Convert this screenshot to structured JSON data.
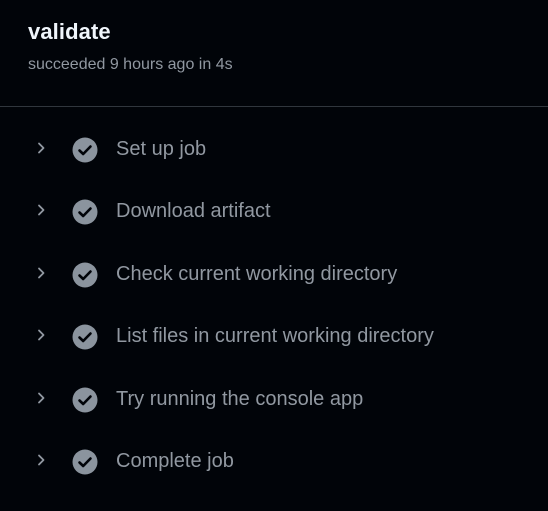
{
  "job": {
    "title": "validate",
    "meta": "succeeded 9 hours ago in 4s"
  },
  "steps": [
    {
      "label": "Set up job",
      "status": "success"
    },
    {
      "label": "Download artifact",
      "status": "success"
    },
    {
      "label": "Check current working directory",
      "status": "success"
    },
    {
      "label": "List files in current working directory",
      "status": "success"
    },
    {
      "label": "Try running the console app",
      "status": "success"
    },
    {
      "label": "Complete job",
      "status": "success"
    }
  ],
  "colors": {
    "background": "#010409",
    "title": "#f0f6fc",
    "muted": "#9198a1",
    "check_circle": "#8b949e",
    "divider": "#30363d"
  },
  "icons": {
    "expand": "chevron-right-icon",
    "status": "check-circle-icon"
  }
}
